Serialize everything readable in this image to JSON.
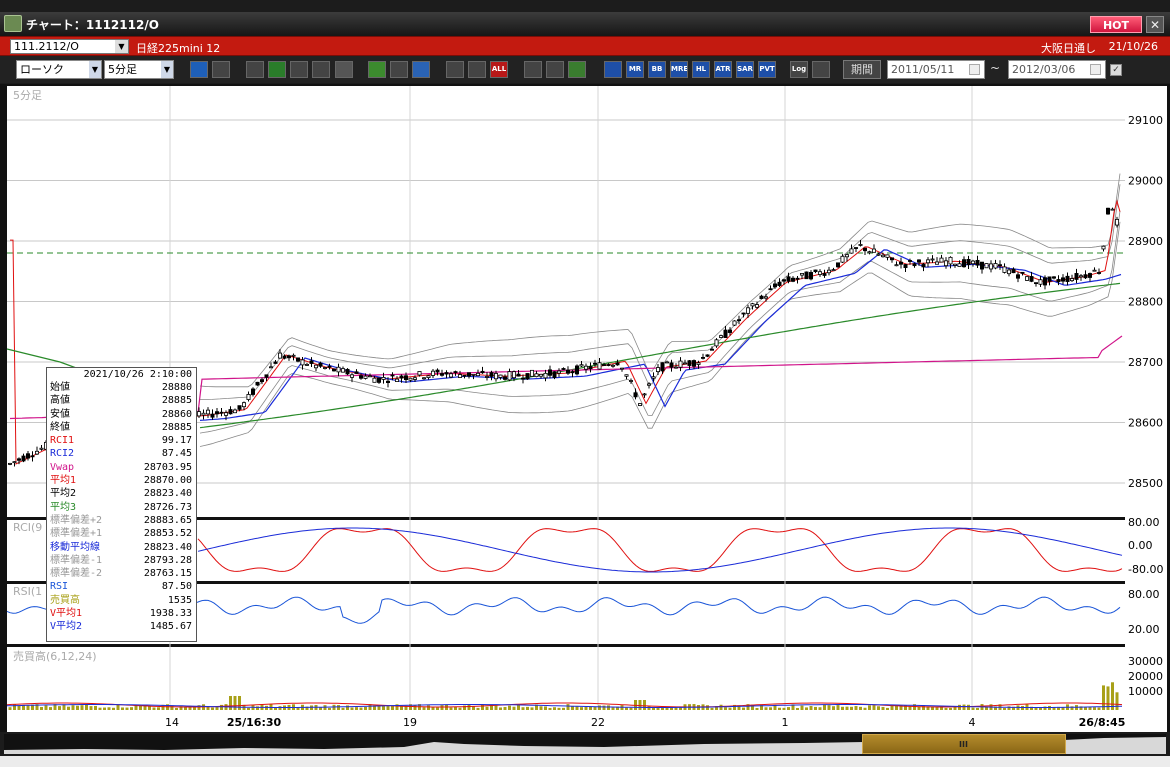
{
  "window": {
    "title": "チャート：1112112/O",
    "hot_label": "HOT",
    "close_label": "✕"
  },
  "symbol_bar": {
    "code": "111.2112/O",
    "name": "日経225mini 12",
    "market": "大阪日通し",
    "date": "21/10/26"
  },
  "toolbar": {
    "chart_type": "ローソク",
    "interval": "5分足",
    "icons": [
      "zoom-icon",
      "crosshair-icon",
      "pointer-icon",
      "drawing-icon",
      "trendline-icon",
      "fibo-icon",
      "alert-icon",
      "pen-icon",
      "cursor-icon",
      "undo-icon",
      "candle-icon",
      "bars-icon",
      "all-icon",
      "settings-icon",
      "wrench-icon",
      "palette-icon",
      "ma-icon",
      "mr-icon",
      "bb-icon",
      "mre-icon",
      "hl-icon",
      "atr-icon",
      "sar-icon",
      "pvt-icon",
      "log-icon",
      "grid-icon"
    ],
    "icon_labels": [
      "",
      "",
      "",
      "",
      "",
      "",
      "",
      "",
      "",
      "",
      "",
      "",
      "ALL",
      "",
      "",
      "",
      "",
      "MR",
      "BB",
      "MRE",
      "HL",
      "ATR",
      "SAR",
      "PVT",
      "Log",
      ""
    ],
    "period_label": "期間",
    "date_from": "2011/05/11",
    "date_to": "2012/03/06",
    "tilde": "~"
  },
  "chart": {
    "main_label": "5分足",
    "price_axis": [
      "29100",
      "29000",
      "28900",
      "28800",
      "28700",
      "28600",
      "28500"
    ],
    "rci_label": "RCI(9",
    "rci_axis": [
      "80.00",
      "0.00",
      "-80.00"
    ],
    "rsi_label": "RSI(1",
    "rsi_axis": [
      "80.00",
      "20.00"
    ],
    "volume_label": "売買高(6,12,24)",
    "volume_axis": [
      "30000",
      "20000",
      "10000"
    ],
    "x_axis": [
      "14",
      "25/16:30",
      "19",
      "22",
      "1",
      "4",
      "26/8:45"
    ],
    "colors": {
      "up": "#ffffff",
      "down": "#000000",
      "ma1": "#e01010",
      "ma2": "#1a2bd8",
      "ma3": "#2a8a2a",
      "vwap": "#d0148a",
      "bands": "#888888",
      "rci": "#e01010",
      "rci2": "#1a2bd8",
      "rsi": "#1a55d8",
      "volume": "#a8a018"
    }
  },
  "infobox": {
    "datetime": "2021/10/26  2:10:00",
    "rows": [
      {
        "label": "始値",
        "value": "28880",
        "color": "#000000"
      },
      {
        "label": "高値",
        "value": "28885",
        "color": "#000000"
      },
      {
        "label": "安値",
        "value": "28860",
        "color": "#000000"
      },
      {
        "label": "終値",
        "value": "28885",
        "color": "#000000"
      },
      {
        "label": "RCI1",
        "value": "99.17",
        "color": "#e01010"
      },
      {
        "label": "RCI2",
        "value": "87.45",
        "color": "#1a2bd8"
      },
      {
        "label": "Vwap",
        "value": "28703.95",
        "color": "#d0148a"
      },
      {
        "label": "平均1",
        "value": "28870.00",
        "color": "#e01010"
      },
      {
        "label": "平均2",
        "value": "28823.40",
        "color": "#000000"
      },
      {
        "label": "平均3",
        "value": "28726.73",
        "color": "#2a8a2a"
      },
      {
        "label": "標準偏差+2",
        "value": "28883.65",
        "color": "#999999"
      },
      {
        "label": "標準偏差+1",
        "value": "28853.52",
        "color": "#999999"
      },
      {
        "label": "移動平均線",
        "value": "28823.40",
        "color": "#1a2bd8"
      },
      {
        "label": "標準偏差-1",
        "value": "28793.28",
        "color": "#999999"
      },
      {
        "label": "標準偏差-2",
        "value": "28763.15",
        "color": "#999999"
      },
      {
        "label": "RSI",
        "value": "87.50",
        "color": "#1a55d8"
      },
      {
        "label": "売買高",
        "value": "1535",
        "color": "#a8a018"
      },
      {
        "label": "V平均1",
        "value": "1938.33",
        "color": "#e01010"
      },
      {
        "label": "V平均2",
        "value": "1485.67",
        "color": "#1a2bd8"
      }
    ]
  }
}
